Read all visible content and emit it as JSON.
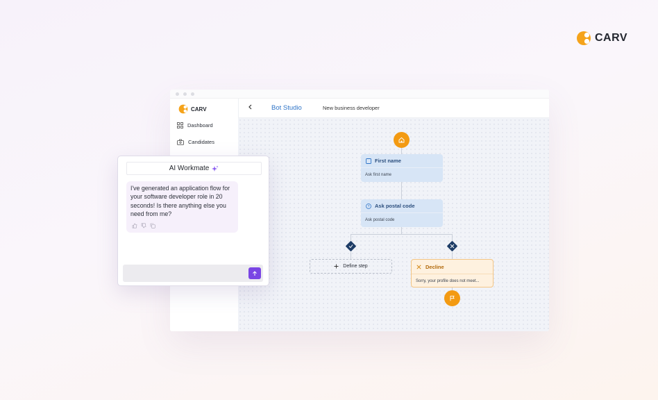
{
  "brand": {
    "name": "CARV"
  },
  "app": {
    "sidebar": {
      "logo": "CARV",
      "items": [
        {
          "label": "Dashboard",
          "icon": "grid-icon"
        },
        {
          "label": "Candidates",
          "icon": "briefcase-icon"
        }
      ]
    },
    "header": {
      "title": "Bot Studio",
      "subtitle": "New business developer"
    },
    "flow": {
      "nodes": [
        {
          "title": "First name",
          "subtitle": "Ask first name",
          "icon": "checkbox-icon"
        },
        {
          "title": "Ask postal code",
          "subtitle": "Ask postal code",
          "icon": "question-icon"
        }
      ],
      "define_step": "Define step",
      "decline": {
        "title": "Decline",
        "subtitle": "Sorry, your profile does not meet..."
      }
    }
  },
  "chat": {
    "title": "AI Workmate",
    "message": "I've generated an application flow for your software developer role in 20 seconds! Is there anything else you need from me?",
    "input_value": ""
  },
  "colors": {
    "accent_orange": "#f39a12",
    "node_blue": "#d7e5f6",
    "header_blue": "#2f74c7",
    "send_purple": "#7a45e4",
    "diamond_navy": "#1d3c66"
  }
}
